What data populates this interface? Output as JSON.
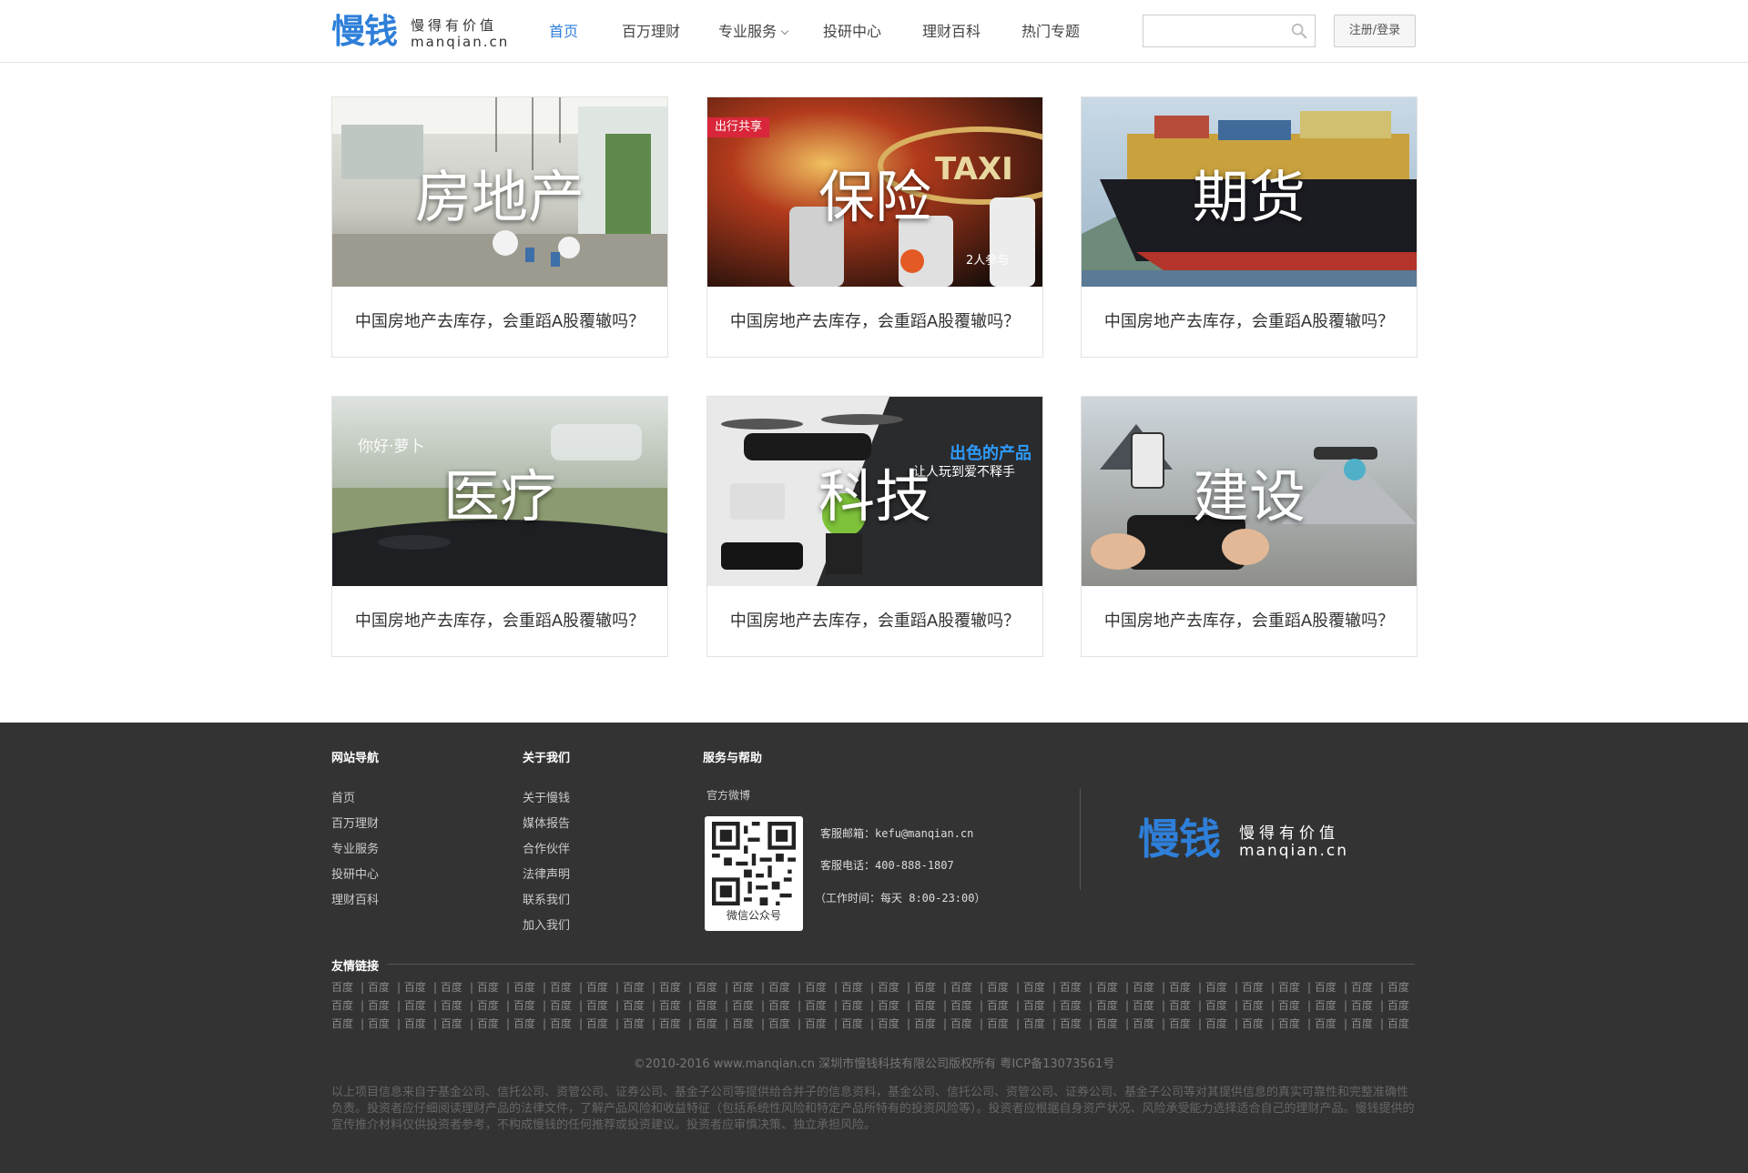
{
  "header": {
    "logo_cn": "慢钱",
    "logo_slogan": "慢得有价值",
    "logo_domain": "manqian.cn",
    "nav": [
      {
        "label": "首页",
        "active": true
      },
      {
        "label": "百万理财",
        "active": false
      },
      {
        "label": "专业服务",
        "active": false,
        "dropdown": true
      },
      {
        "label": "投研中心",
        "active": false
      },
      {
        "label": "理财百科",
        "active": false
      },
      {
        "label": "热门专题",
        "active": false
      }
    ],
    "search_placeholder": "",
    "search_icon": "search-icon",
    "login_label": "注册/登录"
  },
  "cards": [
    {
      "category": "房地产",
      "caption": "中国房地产去库存，会重蹈A股覆辙吗？"
    },
    {
      "category": "保险",
      "caption": "中国房地产去库存，会重蹈A股覆辙吗？",
      "tag": "出行共享",
      "extra": "2人参与"
    },
    {
      "category": "期货",
      "caption": "中国房地产去库存，会重蹈A股覆辙吗？"
    },
    {
      "category": "医疗",
      "caption": "中国房地产去库存，会重蹈A股覆辙吗？",
      "overlay_text": "你好·萝卜"
    },
    {
      "category": "科技",
      "caption": "中国房地产去库存，会重蹈A股覆辙吗？",
      "overlay_text": "出色的产品",
      "overlay_sub": "让人玩到爱不释手"
    },
    {
      "category": "建设",
      "caption": "中国房地产去库存，会重蹈A股覆辙吗？"
    }
  ],
  "footer": {
    "nav_title": "网站导航",
    "nav_links": [
      "首页",
      "百万理财",
      "专业服务",
      "投研中心",
      "理财百科"
    ],
    "about_title": "关于我们",
    "about_links": [
      "关于慢钱",
      "媒体报告",
      "合作伙伴",
      "法律声明",
      "联系我们",
      "加入我们"
    ],
    "service_title": "服务与帮助",
    "weibo_label": "官方微博",
    "qr_label": "微信公众号",
    "email_label": "客服邮箱：",
    "email_value": "kefu@manqian.cn",
    "phone_label": "客服电话：",
    "phone_value": "400-888-1807",
    "hours": "（工作时间：每天 8:00-23:00）",
    "logo_cn": "慢钱",
    "logo_slogan": "慢得有价值",
    "logo_domain": "manqian.cn",
    "friend_title": "友情链接",
    "friend_link_label": "百度",
    "friend_rows": 3,
    "friend_cols": 30,
    "copyright": "©2010-2016 www.manqian.cn 深圳市慢钱科技有限公司版权所有   粤ICP备13073561号",
    "disclaimer": "以上项目信息来自于基金公司、信托公司、资管公司、证券公司、基金子公司等提供给合并子的信息资料，基金公司、信托公司、资管公司、证券公司、基金子公司等对其提供信息的真实可靠性和完整准确性负责。投资者应仔细阅读理财产品的法律文件，了解产品风险和收益特征（包括系统性风险和特定产品所特有的投资风险等）。投资者应根据自身资产状况、风险承受能力选择适合自己的理财产品。慢钱提供的宣传推介材料仅供投资者参考，不构成慢钱的任何推荐或投资建议。投资者应审慎决策、独立承担风险。"
  }
}
